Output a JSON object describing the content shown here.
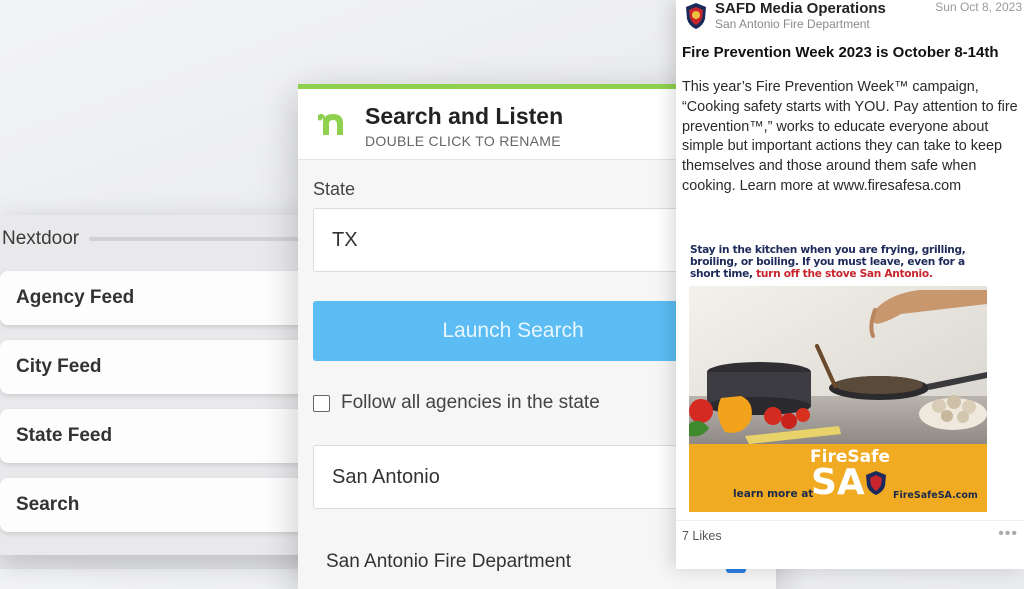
{
  "nextdoor": {
    "title": "Nextdoor",
    "items": [
      {
        "label": "Agency Feed"
      },
      {
        "label": "City Feed"
      },
      {
        "label": "State Feed"
      },
      {
        "label": "Search"
      }
    ]
  },
  "search_listen": {
    "title": "Search and Listen",
    "subtitle": "DOUBLE CLICK TO RENAME",
    "state_label": "State",
    "state_value": "TX",
    "launch_button": "Launch Search",
    "follow_all_label": "Follow all agencies in the state",
    "follow_all_checked": false,
    "city_value": "San Antonio",
    "result": {
      "label": "San Antonio Fire Department",
      "checked": true
    },
    "accent_color": "#8fd14f",
    "button_color": "#5bbdf3"
  },
  "post": {
    "org_name": "SAFD Media Operations",
    "department": "San Antonio Fire Department",
    "date": "Sun Oct 8, 2023",
    "title": "Fire Prevention Week 2023 is October 8-14th",
    "body": "This year’s Fire Prevention Week™ campaign, “Cooking safety starts with YOU. Pay attention to fire prevention™,” works to educate everyone about simple but important actions they can take to keep themselves and those around them safe when cooking. Learn more at www.firesafesa.com",
    "image": {
      "caption_main": "Stay in the kitchen when you are frying, grilling, broiling, or boiling. If you must leave, even for a short time, ",
      "caption_highlight": "turn off the stove San Antonio.",
      "brand_top": "FireSafe",
      "brand_big": "SA",
      "learn_more": "learn more at",
      "url": "FireSafeSA.com"
    },
    "likes": "7 Likes",
    "more_icon": "ellipsis-icon"
  }
}
